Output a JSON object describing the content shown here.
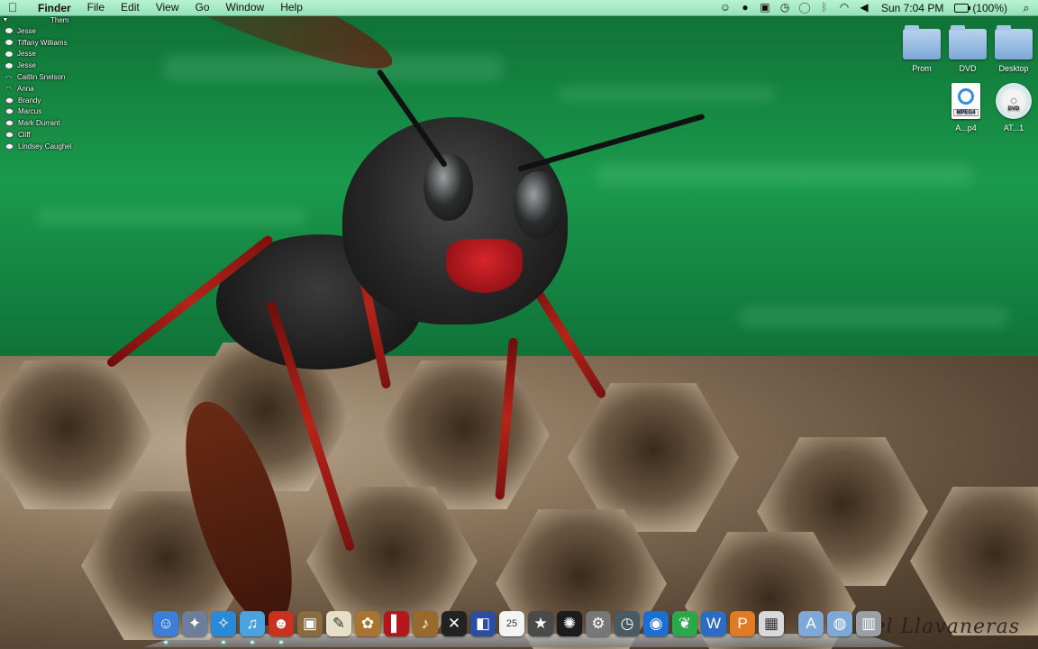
{
  "menubar": {
    "apple_icon": "apple-icon",
    "app_name": "Finder",
    "menus": [
      "File",
      "Edit",
      "View",
      "Go",
      "Window",
      "Help"
    ],
    "status_icons": [
      "growl-icon",
      "record-icon",
      "evernote-icon",
      "time-machine-icon",
      "chat-bubble-icon",
      "bluetooth-icon",
      "wifi-icon",
      "volume-icon"
    ],
    "clock": "Sun 7:04 PM",
    "battery": "(100%)",
    "spotlight_icon": "spotlight-search-icon"
  },
  "buddy_list": {
    "group": "Them",
    "buddies": [
      {
        "name": "Jesse",
        "status": "available"
      },
      {
        "name": "Tiffany Williams",
        "status": "available"
      },
      {
        "name": "Jesse",
        "status": "available"
      },
      {
        "name": "Jesse",
        "status": "available"
      },
      {
        "name": "Caitlin Snelson",
        "status": "wifi"
      },
      {
        "name": "Anna",
        "status": "wifi"
      },
      {
        "name": "Brandy",
        "status": "away"
      },
      {
        "name": "Marcus",
        "status": "idle"
      },
      {
        "name": "Mark Durrant",
        "status": "away"
      },
      {
        "name": "Cliff",
        "status": "away"
      },
      {
        "name": "Lindsey Caughel",
        "status": "away"
      }
    ]
  },
  "desktop_icons": [
    {
      "label": "Prom",
      "type": "folder"
    },
    {
      "label": "DVD",
      "type": "folder"
    },
    {
      "label": "Desktop",
      "type": "folder"
    },
    {
      "label": "A...p4",
      "type": "mpeg",
      "badge": "MPEG4"
    },
    {
      "label": "AT...1",
      "type": "dvd",
      "badge": "DVD"
    }
  ],
  "dock": {
    "items": [
      {
        "name": "finder-icon",
        "glyph": "☺",
        "color": "#3b7fd8",
        "running": true
      },
      {
        "name": "preview-icon",
        "glyph": "✦",
        "color": "#6b7f9c",
        "running": false
      },
      {
        "name": "safari-icon",
        "glyph": "✧",
        "color": "#2a8ad8",
        "running": true
      },
      {
        "name": "itunes-icon",
        "glyph": "♫",
        "color": "#4aa3e0",
        "running": true
      },
      {
        "name": "adium-icon",
        "glyph": "☻",
        "color": "#c8321e",
        "running": true
      },
      {
        "name": "iphoto-icon",
        "glyph": "▣",
        "color": "#8a6b3f",
        "running": false
      },
      {
        "name": "textedit-icon",
        "glyph": "✎",
        "color": "#e6e0c8",
        "running": false
      },
      {
        "name": "ichat-theater-icon",
        "glyph": "✿",
        "color": "#a8742e",
        "running": false
      },
      {
        "name": "photo-booth-icon",
        "glyph": "▌",
        "color": "#b3161b",
        "running": false
      },
      {
        "name": "garageband-icon",
        "glyph": "♪",
        "color": "#9a6a2c",
        "running": false
      },
      {
        "name": "xcode-icon",
        "glyph": "✕",
        "color": "#222",
        "running": false
      },
      {
        "name": "imovie-icon",
        "glyph": "◧",
        "color": "#2a4fa0",
        "running": false
      },
      {
        "name": "ical-icon",
        "glyph": "25",
        "color": "#f4f4f4",
        "running": false
      },
      {
        "name": "imovie-star-icon",
        "glyph": "★",
        "color": "#4a4a4a",
        "running": false
      },
      {
        "name": "front-row-icon",
        "glyph": "✺",
        "color": "#1b1b1b",
        "running": false
      },
      {
        "name": "system-preferences-icon",
        "glyph": "⚙",
        "color": "#777",
        "running": false
      },
      {
        "name": "time-machine-icon",
        "glyph": "◷",
        "color": "#4a5a63",
        "running": false
      },
      {
        "name": "quicktime-icon",
        "glyph": "◉",
        "color": "#1a6fd0",
        "running": false
      },
      {
        "name": "growl-icon",
        "glyph": "❦",
        "color": "#2aa84a",
        "running": false
      },
      {
        "name": "word-icon",
        "glyph": "W",
        "color": "#2b6cc4",
        "running": false
      },
      {
        "name": "powerpoint-icon",
        "glyph": "P",
        "color": "#e07a23",
        "running": false
      },
      {
        "name": "excel-icon",
        "glyph": "▦",
        "color": "#d9d9d9",
        "running": false
      },
      {
        "name": "applications-folder-icon",
        "glyph": "A",
        "color": "#7ea8d8",
        "running": false
      },
      {
        "name": "downloads-folder-icon",
        "glyph": "◍",
        "color": "#7ea8d8",
        "running": false
      },
      {
        "name": "trash-icon",
        "glyph": "▥",
        "color": "#9aa0a5",
        "running": false
      }
    ]
  },
  "wallpaper": {
    "signature": "iel Llavaneras"
  }
}
